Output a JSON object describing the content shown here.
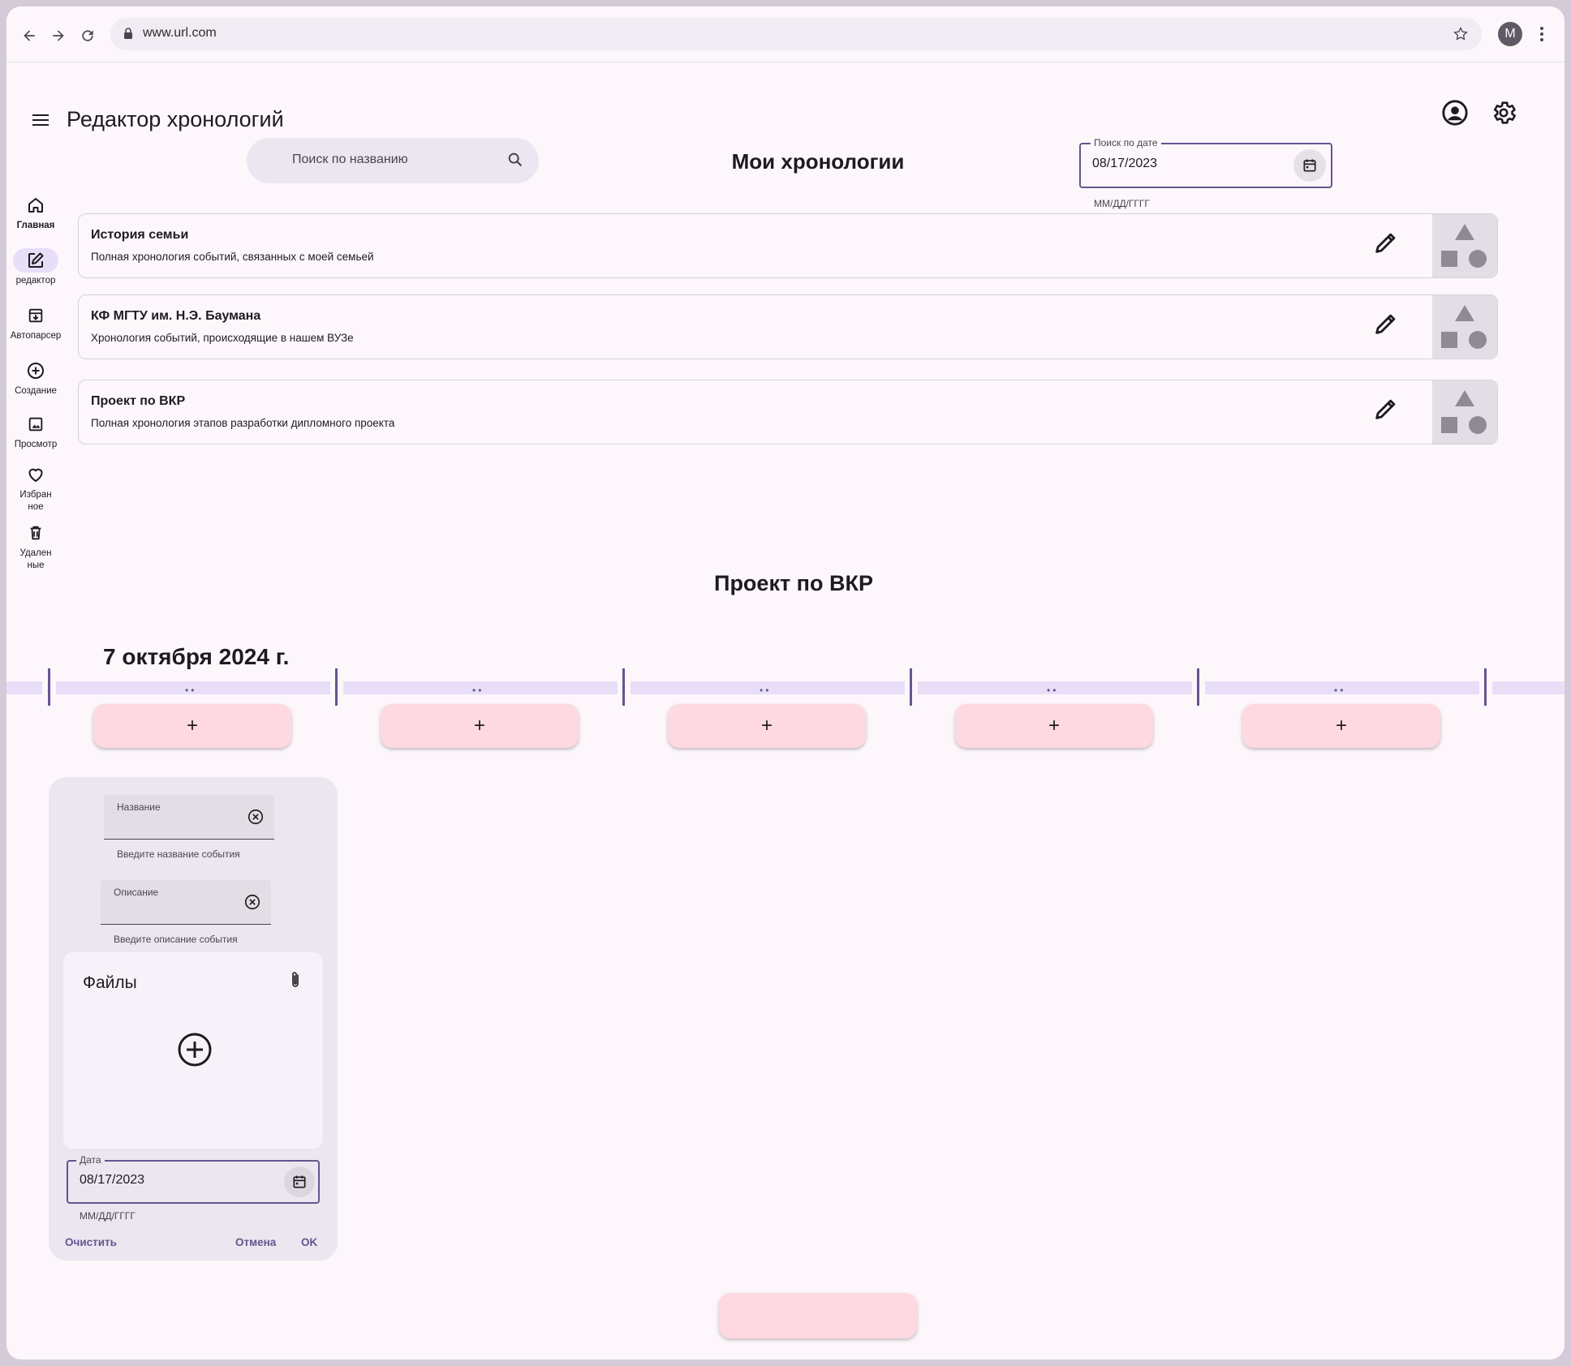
{
  "browser": {
    "url": "www.url.com",
    "profile_initial": "M"
  },
  "app": {
    "title": "Редактор хронологий"
  },
  "rail": {
    "items": [
      {
        "label": "Главная",
        "icon": "home-icon"
      },
      {
        "label": "редактор",
        "icon": "edit-square-icon",
        "active": true
      },
      {
        "label": "Автопарсер",
        "icon": "archive-download-icon"
      },
      {
        "label": "Создание",
        "icon": "add-circle-icon"
      },
      {
        "label": "Просмотр",
        "icon": "image-icon"
      },
      {
        "label": "Избран\nное",
        "icon": "heart-icon"
      },
      {
        "label": "Удален\nные",
        "icon": "trash-icon"
      }
    ]
  },
  "search": {
    "placeholder": "Поиск по названию"
  },
  "section": {
    "title": "Мои хронологии"
  },
  "date_filter": {
    "label": "Поиск по дате",
    "value": "08/17/2023",
    "hint": "ММ/ДД/ГГГГ"
  },
  "timelines": [
    {
      "title": "История семьи",
      "description": "Полная хронология событий, связанных с моей семьей"
    },
    {
      "title": "КФ МГТУ им. Н.Э. Баумана",
      "description": "Хронология событий, происходящие в нашем ВУЗе"
    },
    {
      "title": "Проект по ВКР",
      "description": "Полная хронология этапов разработки дипломного проекта"
    }
  ],
  "timeline_view": {
    "title": "Проект по ВКР",
    "date": "7 октября 2024 г.",
    "add_label": "+",
    "slot_count": 5
  },
  "event_form": {
    "name_label": "Название",
    "name_hint": "Введите название события",
    "desc_label": "Описание",
    "desc_hint": "Введите описание события",
    "files_title": "Файлы",
    "date_label": "Дата",
    "date_value": "08/17/2023",
    "date_hint": "ММ/ДД/ГГГГ",
    "clear_label": "Очистить",
    "cancel_label": "Отмена",
    "ok_label": "OK"
  },
  "colors": {
    "primary": "#65558f",
    "surface": "#fdf7fc",
    "container": "#ece6f0",
    "pink_button": "#ffd9e2",
    "track": "#e8def8"
  }
}
